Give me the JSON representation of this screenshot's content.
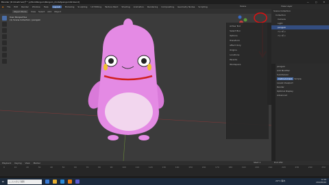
{
  "title": "Blender [D:\\OneDrive\\ゲーム\\WorkPenguin\\Penguin_model\\penguin02.blend]",
  "menu": {
    "items": [
      "File",
      "Edit",
      "Render",
      "Window",
      "Help",
      "Layout",
      "Modeling",
      "Sculpting",
      "UV Editing",
      "Texture Paint",
      "Shading",
      "Animation",
      "Rendering",
      "Compositing",
      "Geometry Nodes",
      "Scripting"
    ],
    "scene": "Scene",
    "view_layer": "View Layer"
  },
  "viewport": {
    "mode": "Object Mode",
    "view": "View",
    "select": "Select",
    "add": "Add",
    "object": "Object",
    "overlay1": "User Perspective",
    "overlay2": "(1) Scene Collection | penguin"
  },
  "npanel": {
    "active_tool": "Active Tool",
    "select_box": "Select Box",
    "options": "Options",
    "transform": "Transform",
    "affect_only": "Affect Only",
    "origins": "Origins",
    "locations": "Locations",
    "parents": "Parents",
    "workspace": "Workspace"
  },
  "outliner": {
    "rows": [
      {
        "label": "Scene Collection",
        "sel": false
      },
      {
        "label": "Collection",
        "sel": false
      },
      {
        "label": "Camera",
        "sel": false
      },
      {
        "label": "Light",
        "sel": false
      },
      {
        "label": "penguin",
        "sel": true
      },
      {
        "label": "ペンギン",
        "sel": false
      },
      {
        "label": "ペンギン",
        "sel": false
      }
    ]
  },
  "properties": {
    "object": "penguin",
    "modifier": "Subdivision",
    "add_modifier": "Add Modifier",
    "catmull": "Catmull-Clark",
    "simple": "Simple",
    "levels_viewport": "Levels Viewport",
    "render": "Render",
    "optimal": "Optimal Display",
    "advanced": "Advanced"
  },
  "timeline": {
    "items": [
      "Playback",
      "Keying",
      "View",
      "Marker"
    ],
    "ticks": [
      "0",
      "10",
      "20",
      "30",
      "40",
      "50",
      "60",
      "70",
      "80",
      "90",
      "100",
      "110",
      "120",
      "130",
      "140",
      "150",
      "160",
      "170",
      "180",
      "190",
      "200",
      "210",
      "220",
      "230",
      "240",
      "250"
    ],
    "start": "Start 1",
    "end": "End 250"
  },
  "taskbar": {
    "search": "ここに入力して検索",
    "weather": "20°C 晴れ",
    "time": "12:18",
    "date": "2022/06/02"
  }
}
